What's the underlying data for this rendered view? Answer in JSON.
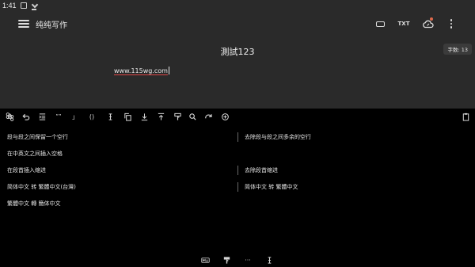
{
  "status_bar": {
    "time": "1:41"
  },
  "app_bar": {
    "title": "纯纯写作",
    "txt_button": "TXT"
  },
  "document": {
    "title": "測試123",
    "body": "www.115wg.com",
    "word_count": "字数: 13"
  },
  "commands": [
    {
      "id": "keep-one-blank-line",
      "label": "段与段之间保留一个空行"
    },
    {
      "id": "remove-extra-blank-lines",
      "label": "去除段与段之间多余的空行"
    },
    {
      "id": "add-space-cjk-latin",
      "label": "在中英文之间插入空格"
    },
    {
      "id": "indent-paragraph",
      "label": "在段首插入缩进"
    },
    {
      "id": "remove-indent",
      "label": "去除段首缩进"
    },
    {
      "id": "to-traditional-tw",
      "label": "简体中文 转 繁體中文(台灣)"
    },
    {
      "id": "to-traditional",
      "label": "简体中文 转 繁體中文"
    },
    {
      "id": "to-simplified",
      "label": "繁體中文 轉 簡体中文"
    }
  ],
  "toolbar_glyphs": {
    "quote": "””",
    "bracket": "」",
    "paren": "()",
    "more": "···"
  },
  "colors": {
    "background_top": "#2a2a2a",
    "panel": "#000000",
    "notification_dot": "#e06a4c",
    "spellcheck_underline": "#e04646"
  }
}
